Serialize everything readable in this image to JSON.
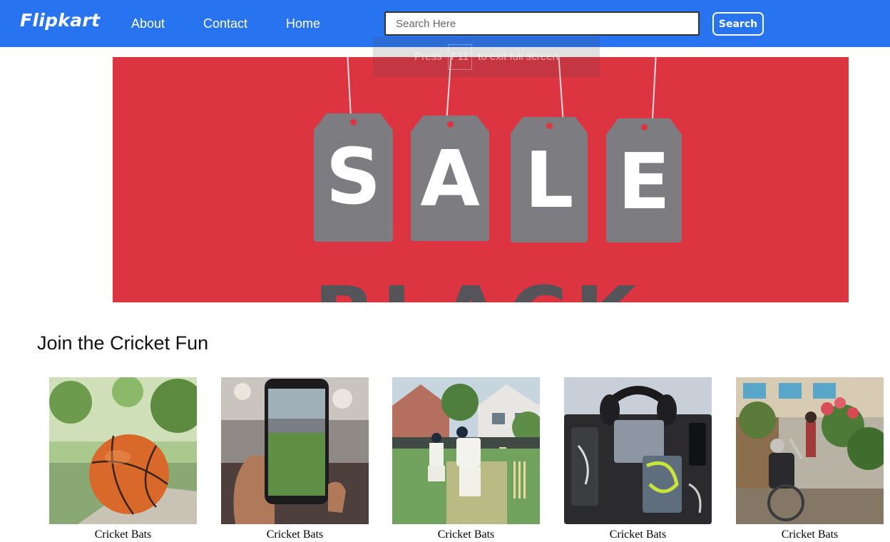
{
  "navbar": {
    "brand": "Flipkart",
    "links": [
      {
        "label": "About"
      },
      {
        "label": "Contact"
      },
      {
        "label": "Home"
      }
    ],
    "search": {
      "placeholder": "Search Here",
      "value": "",
      "button_label": "Search"
    }
  },
  "overlay": {
    "prefix": "Press",
    "key": "F11",
    "suffix": "to exit full screen"
  },
  "banner": {
    "tag_letters": [
      "S",
      "A",
      "L",
      "E"
    ],
    "bottom_word": "BLACK",
    "colors": {
      "background": "#dd3442",
      "tag": "#7d7c80"
    }
  },
  "section": {
    "title": "Join the Cricket Fun"
  },
  "products": [
    {
      "label": "Cricket Bats",
      "image": "orange basketball on grass"
    },
    {
      "label": "Cricket Bats",
      "image": "hand holding phone filming stadium"
    },
    {
      "label": "Cricket Bats",
      "image": "cricket batsman and wicketkeeper"
    },
    {
      "label": "Cricket Bats",
      "image": "headphones and cables gadget organizer"
    },
    {
      "label": "Cricket Bats",
      "image": "wheelchair user reaching toward flowers"
    }
  ],
  "theme": {
    "accent": "#2874f0"
  }
}
